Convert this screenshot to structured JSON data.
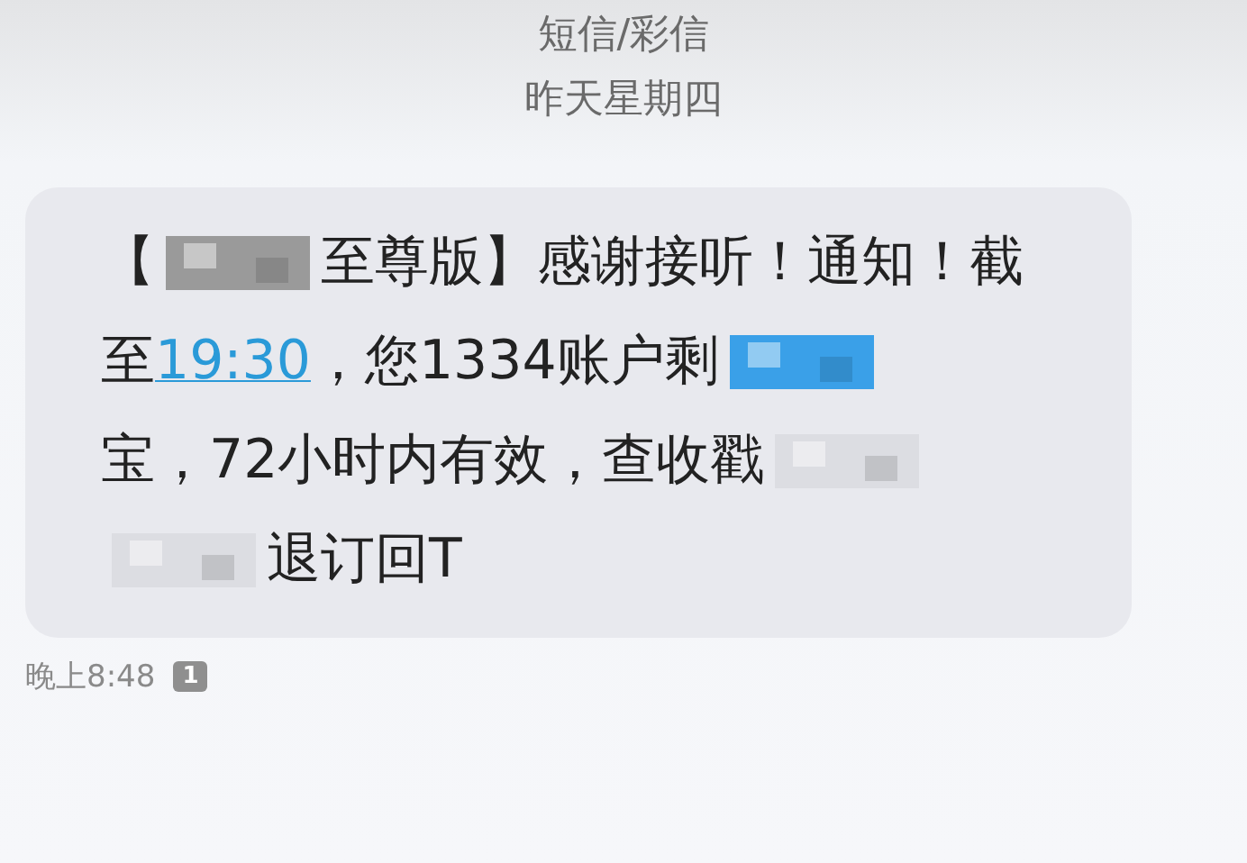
{
  "header": {
    "title": "短信/彩信",
    "date": "昨天星期四"
  },
  "message": {
    "lines": [
      [
        {
          "kind": "text",
          "text": "【"
        },
        {
          "kind": "redacted",
          "color": "#9a9a9a"
        },
        {
          "kind": "text",
          "text": "至尊版】感谢接听！通知！截"
        }
      ],
      [
        {
          "kind": "text",
          "text": "至"
        },
        {
          "kind": "link",
          "text": "19:30"
        },
        {
          "kind": "text",
          "text": "，您1334账户剩"
        },
        {
          "kind": "redacted",
          "color": "#3aa0e8"
        }
      ],
      [
        {
          "kind": "text",
          "text": "宝，72小时内有效，查收戳"
        },
        {
          "kind": "redacted",
          "color": "#dcdde2"
        }
      ],
      [
        {
          "kind": "redacted",
          "color": "#dcdde2"
        },
        {
          "kind": "text",
          "text": "退订回T"
        }
      ]
    ],
    "time": "晚上8:48",
    "sim": "1"
  }
}
